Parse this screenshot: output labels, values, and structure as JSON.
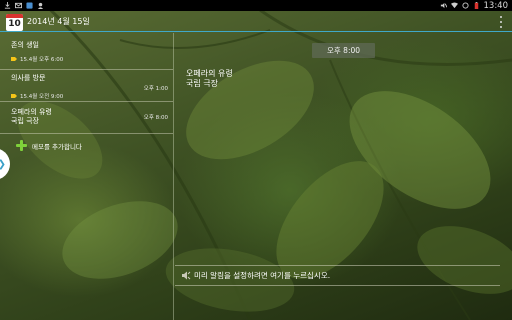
{
  "status_bar": {
    "clock": "13:40",
    "left_icons": [
      "download-icon",
      "mail-icon",
      "image-icon",
      "user-icon"
    ],
    "right_icons": [
      "mute-icon",
      "wifi-icon",
      "sync-icon",
      "battery-icon"
    ]
  },
  "header": {
    "calendar_day": "10",
    "date": "2014년 4월 15일",
    "menu_icon": "overflow-menu-icon"
  },
  "events": [
    {
      "title": "존의 생일",
      "alarm": "15.4월 오후 6:00",
      "time": ""
    },
    {
      "title": "의사를 방문",
      "alarm": "15.4월 오전 9:00",
      "time": "오후 1:00"
    },
    {
      "title": "오페라의 유령\n국립 극장",
      "alarm": "",
      "time": "오후 8:00"
    }
  ],
  "add_memo": {
    "label": "메모를 추가합니다"
  },
  "detail": {
    "time": "오후 8:00",
    "title": "오페라의 유령\n국립 극장",
    "reminder": "미리 알림을 설정하려면 여기를 누르십시오."
  },
  "colors": {
    "accent": "#3fa8c8",
    "calendar_red": "#d8332e",
    "plus_green": "#7fd13a",
    "status_bar": "#000000"
  }
}
